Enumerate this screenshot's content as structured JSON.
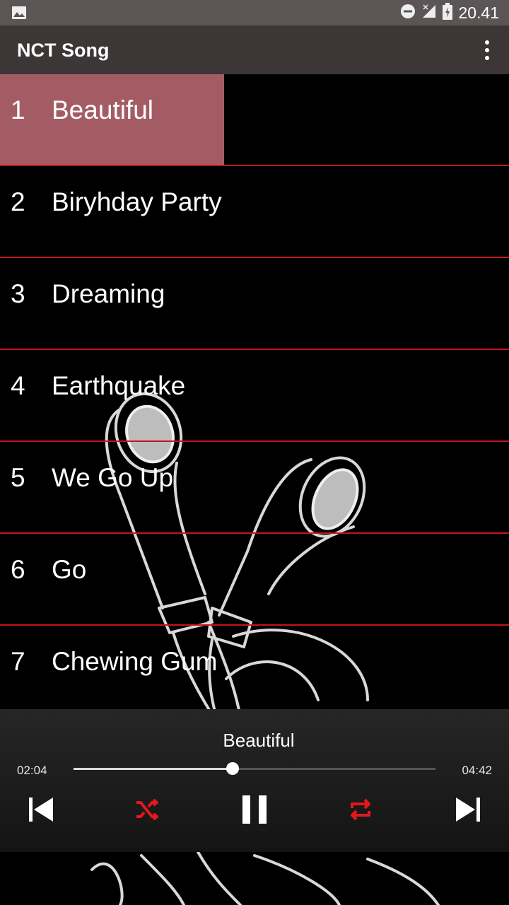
{
  "status_bar": {
    "time": "20.41"
  },
  "app_bar": {
    "title": "NCT Song",
    "menu_icon": "more-vert-icon"
  },
  "songs": [
    {
      "num": "1",
      "title": "Beautiful",
      "active": true
    },
    {
      "num": "2",
      "title": "Biryhday Party"
    },
    {
      "num": "3",
      "title": "Dreaming"
    },
    {
      "num": "4",
      "title": "Earthquake"
    },
    {
      "num": "5",
      "title": "We Go Up"
    },
    {
      "num": "6",
      "title": "Go"
    },
    {
      "num": "7",
      "title": "Chewing Gum"
    }
  ],
  "player": {
    "now_playing": "Beautiful",
    "current_time": "02:04",
    "duration": "04:42",
    "progress": 0.44,
    "controls": [
      "skip-previous-icon",
      "shuffle-icon",
      "pause-icon",
      "repeat-icon",
      "skip-next-icon"
    ]
  },
  "colors": {
    "accent_red": "#c8141c",
    "highlight": "#a45c64",
    "appbar": "#3d3637",
    "statusbar": "#5b5556"
  }
}
